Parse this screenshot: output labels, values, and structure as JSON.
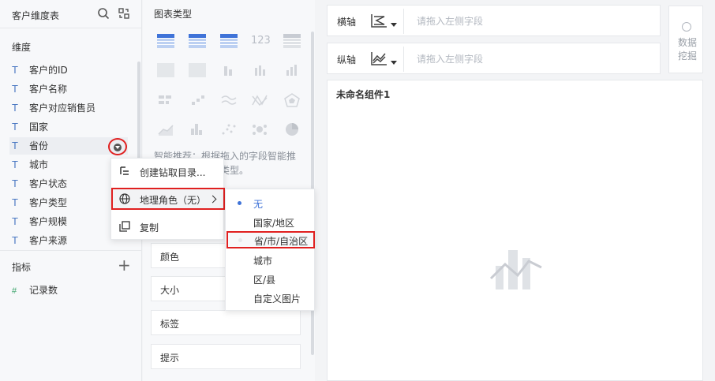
{
  "left_panel": {
    "title": "客户维度表",
    "dimension_title": "维度",
    "dimension_fields": [
      "客户的ID",
      "客户名称",
      "客户对应销售员",
      "国家",
      "省份",
      "城市",
      "客户状态",
      "客户类型",
      "客户规模",
      "客户来源"
    ],
    "field_type_glyph": "T",
    "measure_title": "指标",
    "add_glyph": "+",
    "measure_fields": [
      "记录数"
    ],
    "measure_type_glyph": "#"
  },
  "chart_panel": {
    "title": "图表类型",
    "number_glyph": "123",
    "recommend_text": "智能推荐：根据拖入的字段智能推荐最合适的表格类型。",
    "properties": [
      "颜色",
      "大小",
      "标签",
      "提示"
    ]
  },
  "context_menu": {
    "items": [
      "创建钻取目录...",
      "地理角色（无）",
      "复制"
    ]
  },
  "geo_submenu": {
    "selected": "无",
    "items": [
      "无",
      "国家/地区",
      "省/市/自治区",
      "城市",
      "区/县",
      "自定义图片"
    ]
  },
  "axes": {
    "x_label": "横轴",
    "y_label": "纵轴",
    "placeholder": "请拖入左侧字段"
  },
  "mining_button": "数据挖掘",
  "canvas": {
    "component_name": "未命名组件1"
  },
  "colors": {
    "accent": "#3f73d8",
    "highlight": "#e02020"
  }
}
